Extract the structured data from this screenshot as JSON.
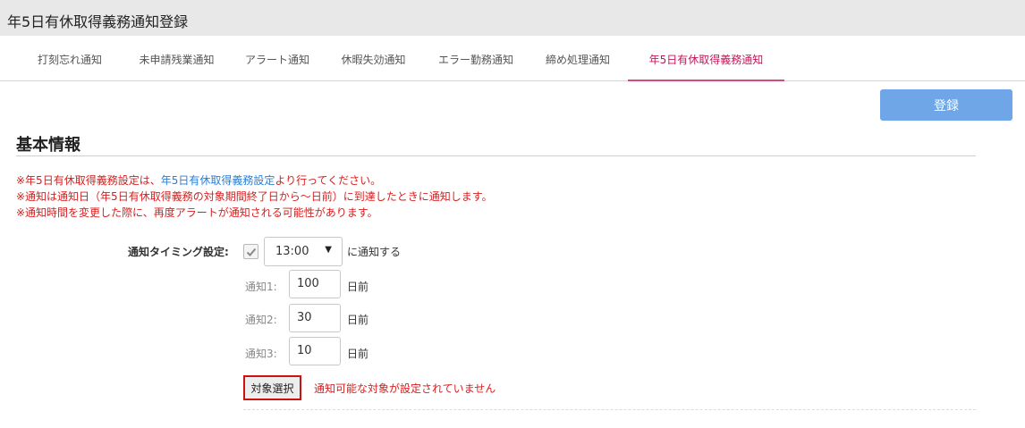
{
  "window": {
    "title": "年5日有休取得義務通知登録"
  },
  "tabs": [
    {
      "label": "打刻忘れ通知",
      "active": false
    },
    {
      "label": "未申請残業通知",
      "active": false
    },
    {
      "label": "アラート通知",
      "active": false
    },
    {
      "label": "休暇失効通知",
      "active": false
    },
    {
      "label": "エラー勤務通知",
      "active": false
    },
    {
      "label": "締め処理通知",
      "active": false
    },
    {
      "label": "年5日有休取得義務通知",
      "active": true
    }
  ],
  "toolbar": {
    "register_label": "登録"
  },
  "section": {
    "title": "基本情報"
  },
  "notes": {
    "line1_prefix": "※年5日有休取得義務設定は、",
    "line1_link": "年5日有休取得義務設定",
    "line1_suffix": "より行ってください。",
    "line2": "※通知は通知日（年5日有休取得義務の対象期間終了日から〜日前）に到達したときに通知します。",
    "line3": "※通知時間を変更した際に、再度アラートが通知される可能性があります。"
  },
  "timing": {
    "label": "通知タイミング設定:",
    "checked": true,
    "time_value": "13:00",
    "suffix": "に通知する"
  },
  "notifications": [
    {
      "label": "通知1:",
      "value": "100",
      "unit": "日前"
    },
    {
      "label": "通知2:",
      "value": "30",
      "unit": "日前"
    },
    {
      "label": "通知3:",
      "value": "10",
      "unit": "日前"
    }
  ],
  "target": {
    "button_label": "対象選択",
    "message": "通知可能な対象が設定されていません"
  },
  "colors": {
    "accent": "#d64a7e",
    "primary_button": "#6ea6e8",
    "warning_text": "#d62020",
    "link": "#2a7ed6"
  },
  "icons": {
    "checkbox": "check-icon",
    "dropdown": "caret-down-icon"
  }
}
